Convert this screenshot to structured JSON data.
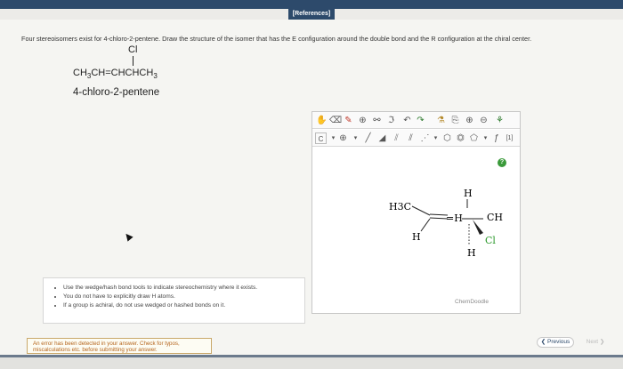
{
  "header": {
    "references_label": "[References]"
  },
  "question": {
    "text": "Four stereoisomers exist for 4-chloro-2-pentene. Draw the structure of the isomer that has the E configuration around the double bond and the R configuration at the chiral center."
  },
  "compound": {
    "substituent": "Cl",
    "formula_main": "CH",
    "formula_sub1": "3",
    "formula_mid": "CH=CHCHCH",
    "formula_sub2": "3",
    "name": "4-chloro-2-pentene"
  },
  "instructions": [
    "Use the wedge/hash bond tools to indicate stereochemistry where it exists.",
    "You do not have to explicitly draw H atoms.",
    "If a group is achiral, do not use wedged or hashed bonds on it."
  ],
  "error": {
    "message": "An error has been detected in your answer. Check for typos, miscalculations etc. before submitting your answer."
  },
  "navigation": {
    "previous_label": "Previous",
    "next_label": "Next"
  },
  "editor": {
    "brand_label": "ChemDoodle",
    "help_label": "?",
    "toolbar1_icons": [
      "hand-icon",
      "eraser-icon",
      "pencil-icon",
      "plus-circle-icon",
      "ring-icon",
      "lasso-icon",
      "undo-icon",
      "redo-icon",
      "template-icon",
      "copy-icon",
      "zoom-in-icon",
      "zoom-out-icon",
      "clean-icon"
    ],
    "toolbar2_icons": [
      "C",
      "▾",
      "⊕",
      "▾",
      "single-bond-icon",
      "wedge-bond-icon",
      "hash-bond-icon",
      "double-bond-icon",
      "▾",
      "cyclohexane-icon",
      "benzene-icon",
      "pentagon-icon",
      "▾",
      "formula-icon",
      "[1]"
    ],
    "atoms": [
      "H3C",
      "H",
      "=H",
      "CH",
      "H",
      "Cl",
      "H"
    ]
  }
}
